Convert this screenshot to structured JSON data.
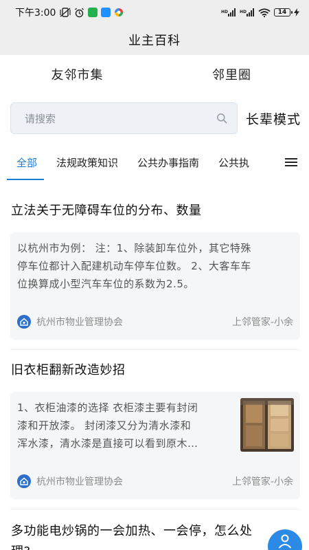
{
  "status_bar": {
    "time": "下午3:00",
    "battery": "14",
    "app_colors": [
      "#23b14d",
      "#1e90ff"
    ]
  },
  "header": {
    "title": "业主百科"
  },
  "top_tabs": [
    {
      "label": "友邻市集"
    },
    {
      "label": "邻里圈"
    }
  ],
  "search": {
    "placeholder": "请搜索"
  },
  "elder_mode": {
    "label": "长辈模式"
  },
  "categories": [
    {
      "label": "全部",
      "active": true
    },
    {
      "label": "法规政策知识"
    },
    {
      "label": "公共办事指南"
    },
    {
      "label": "公共执"
    }
  ],
  "articles": [
    {
      "title": "立法关于无障碍车位的分布、数量",
      "lines": [
        "以杭州市为例： 注：1、除装卸车位外，其它特殊",
        "停车位都计入配建机动车停车位数。 2、大客车车",
        "位换算成小型汽车车位的系数为2.5。"
      ],
      "org": "杭州市物业管理协会",
      "author": "上邻管家-小余"
    },
    {
      "title": "旧衣柜翻新改造妙招",
      "lines": [
        "1、衣柜油漆的选择 衣柜漆主要有封闭",
        "漆和开放漆。 封闭漆又分为清水漆和",
        "浑水漆，清水漆是直接可以看到原木…"
      ],
      "org": "杭州市物业管理协会",
      "author": "上邻管家-小余"
    },
    {
      "title_lines": [
        "多功能电炒锅的一会加热、一会停，怎么处",
        "理?"
      ]
    }
  ],
  "colors": {
    "accent": "#1a7ed8",
    "fab": "#2b8ae6"
  }
}
